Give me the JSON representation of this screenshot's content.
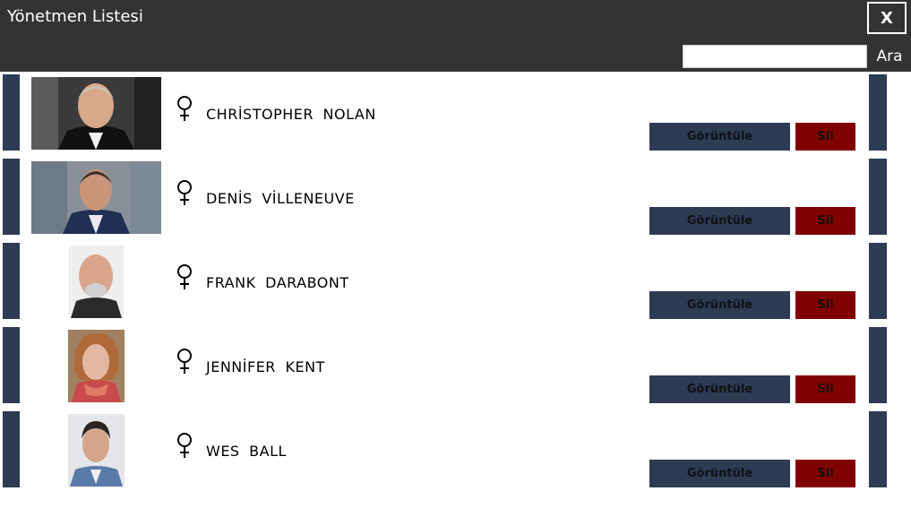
{
  "window": {
    "title": "Yönetmen Listesi",
    "close_label": "X"
  },
  "search": {
    "value": "",
    "placeholder": "",
    "button_label": "Ara"
  },
  "directors": [
    {
      "name": "CHRİSTOPHER  NOLAN",
      "gender_icon": "female-symbol-icon",
      "view_label": "Görüntüle",
      "delete_label": "Sil"
    },
    {
      "name": "DENİS  VİLLENEUVE",
      "gender_icon": "female-symbol-icon",
      "view_label": "Görüntüle",
      "delete_label": "Sil"
    },
    {
      "name": "FRANK  DARABONT",
      "gender_icon": "female-symbol-icon",
      "view_label": "Görüntüle",
      "delete_label": "Sil"
    },
    {
      "name": "JENNİFER  KENT",
      "gender_icon": "female-symbol-icon",
      "view_label": "Görüntüle",
      "delete_label": "Sil"
    },
    {
      "name": "WES  BALL",
      "gender_icon": "female-symbol-icon",
      "view_label": "Görüntüle",
      "delete_label": "Sil"
    }
  ],
  "colors": {
    "titlebar": "#333333",
    "row_accent": "#2d3b54",
    "view_button": "#2d3b54",
    "delete_button": "#800000"
  }
}
